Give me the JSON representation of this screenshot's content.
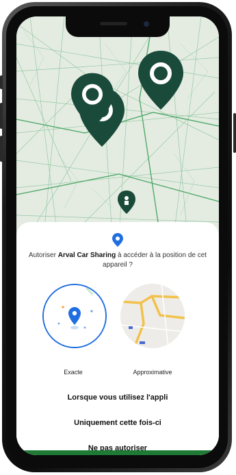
{
  "dialog": {
    "prompt_prefix": "Autoriser ",
    "app_name": "Arval Car Sharing",
    "prompt_suffix": " à accéder à la position de cet appareil ?",
    "exact_label": "Exacte",
    "approx_label": "Approximative",
    "options": [
      "Lorsque vous utilisez l'appli",
      "Uniquement cette fois-ci",
      "Ne pas autoriser"
    ]
  },
  "colors": {
    "brand_green": "#1a4a3a",
    "accent_blue": "#1f6fe0",
    "bottom_bar": "#1e7a34"
  },
  "icons": {
    "map_marker": "map-pin-icon",
    "location": "location-pin-icon"
  }
}
